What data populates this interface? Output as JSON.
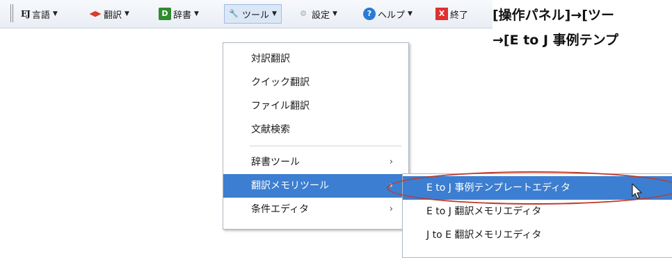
{
  "toolbar": {
    "language_label": "言語",
    "language_badge": "EJ",
    "translate_label": "翻訳",
    "dictionary_label": "辞書",
    "dictionary_badge": "D",
    "tools_label": "ツール",
    "settings_label": "設定",
    "help_label": "ヘルプ",
    "help_badge": "?",
    "exit_label": "終了",
    "exit_badge": "X"
  },
  "annotation": {
    "line1": "[操作パネル]→[ツー",
    "line2": "→[E to J 事例テンプ"
  },
  "tools_menu": {
    "items": [
      {
        "label": "対訳翻訳"
      },
      {
        "label": "クイック翻訳"
      },
      {
        "label": "ファイル翻訳"
      },
      {
        "label": "文献検索"
      },
      {
        "label": "辞書ツール",
        "arrow": "›"
      },
      {
        "label": "翻訳メモリツール",
        "arrow": "›"
      },
      {
        "label": "条件エディタ",
        "arrow": "›"
      }
    ]
  },
  "tm_submenu": {
    "items": [
      {
        "label": "E to J 事例テンプレートエディタ"
      },
      {
        "label": "E to J 翻訳メモリエディタ"
      },
      {
        "label": "J to E 翻訳メモリエディタ"
      }
    ]
  },
  "colors": {
    "highlight": "#3c7ed1",
    "callout": "#c0392b"
  }
}
